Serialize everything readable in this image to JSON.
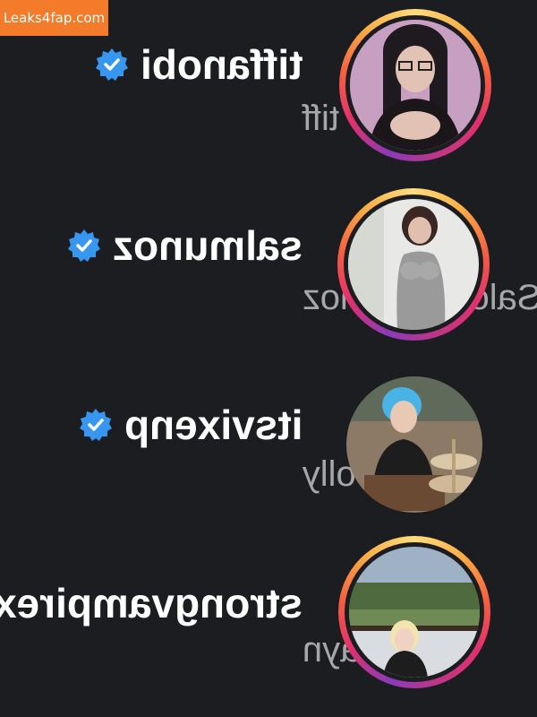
{
  "watermark": "Leaks4fap.com",
  "accounts": [
    {
      "username": "tiffanobi",
      "full_name": "tiff",
      "verified": true,
      "story_ring": true
    },
    {
      "username": "salmunoz",
      "full_name": "Salome Munoz",
      "verified": true,
      "story_ring": true
    },
    {
      "username": "itsvixenp",
      "full_name": "Polly",
      "verified": true,
      "story_ring": false
    },
    {
      "username": "strongvampirex",
      "full_name": "gia layn",
      "verified": false,
      "story_ring": true
    }
  ],
  "colors": {
    "background": "#1c1d21",
    "username": "#ffffff",
    "full_name": "#a7a7ab",
    "verified_badge": "#3797f0",
    "watermark_bg": "#f37b2a"
  }
}
